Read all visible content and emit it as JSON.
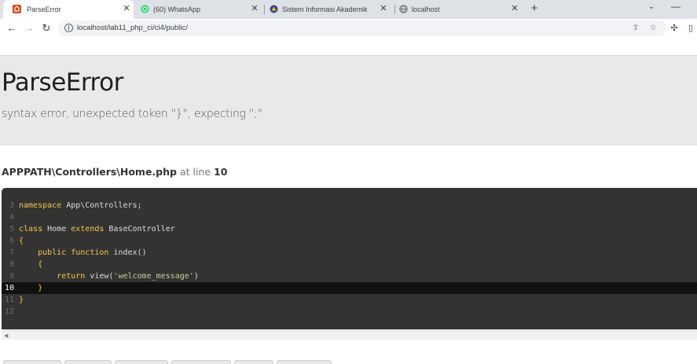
{
  "browser": {
    "tabs": [
      {
        "title": "ParseError",
        "icon": "codeigniter-icon",
        "active": true
      },
      {
        "title": "(60) WhatsApp",
        "icon": "whatsapp-icon",
        "active": false
      },
      {
        "title": "Sistem Informasi Akademik",
        "icon": "university-icon",
        "active": false
      },
      {
        "title": "localhost",
        "icon": "globe-icon",
        "active": false
      }
    ],
    "url": "localhost/lab11_php_ci/ci4/public/"
  },
  "error": {
    "title": "ParseError",
    "message": "syntax error, unexpected token \"}\", expecting \";\""
  },
  "location": {
    "path": "APPPATH\\Controllers\\Home.php",
    "at_line_label": "at line",
    "line": "10"
  },
  "source": {
    "highlight_line": "10",
    "lines": [
      {
        "num": "3",
        "code": "namespace App\\Controllers;"
      },
      {
        "num": "4",
        "code": ""
      },
      {
        "num": "5",
        "code": "class Home extends BaseController"
      },
      {
        "num": "6",
        "code": "{"
      },
      {
        "num": "7",
        "code": "    public function index()"
      },
      {
        "num": "8",
        "code": "    {"
      },
      {
        "num": "9",
        "code": "        return view('welcome_message')"
      },
      {
        "num": "10",
        "code": "    }"
      },
      {
        "num": "11",
        "code": "}"
      },
      {
        "num": "12",
        "code": ""
      }
    ]
  },
  "colors": {
    "codeigniter_brand": "#dd4814",
    "whatsapp_brand": "#25d366",
    "keyword": "#f5c842",
    "string": "#c6d08f",
    "code_background": "#333333",
    "header_background": "#e9e9e9"
  }
}
